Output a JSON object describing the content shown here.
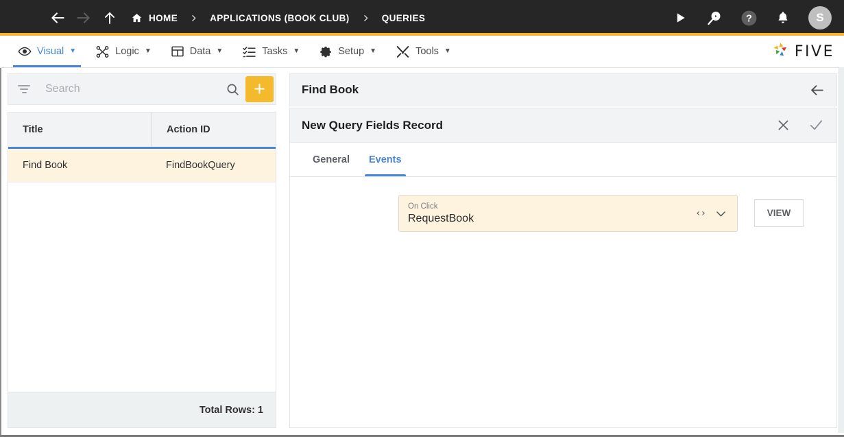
{
  "topbar": {
    "menu_icon": "hamburger-icon",
    "back_icon": "arrow-left-icon",
    "forward_icon": "arrow-right-icon",
    "up_icon": "arrow-up-icon",
    "breadcrumbs": [
      {
        "label": "HOME",
        "icon": "home-icon"
      },
      {
        "label": "APPLICATIONS (BOOK CLUB)",
        "icon": ""
      },
      {
        "label": "QUERIES",
        "icon": ""
      }
    ],
    "separator": "›",
    "actions": [
      {
        "name": "run-icon",
        "label": "Run"
      },
      {
        "name": "debug-search-icon",
        "label": "Debug"
      },
      {
        "name": "help-icon",
        "label": "Help"
      },
      {
        "name": "notifications-bell-icon",
        "label": "Notifications"
      }
    ],
    "avatar_initial": "S",
    "accent_color": "#f3b229",
    "background_color": "#262626"
  },
  "menubar": {
    "items": [
      {
        "label": "Visual",
        "icon": "eye-icon",
        "caret": "▼",
        "active": true
      },
      {
        "label": "Logic",
        "icon": "logic-nodes-icon",
        "caret": "▼",
        "active": false
      },
      {
        "label": "Data",
        "icon": "table-grid-icon",
        "caret": "▼",
        "active": false
      },
      {
        "label": "Tasks",
        "icon": "tasks-list-icon",
        "caret": "▼",
        "active": false
      },
      {
        "label": "Setup",
        "icon": "gear-icon",
        "caret": "▼",
        "active": false
      },
      {
        "label": "Tools",
        "icon": "tools-wrench-icon",
        "caret": "▼",
        "active": false
      }
    ],
    "logo_text": "FIVE",
    "active_color": "#4a86d8"
  },
  "sidebar": {
    "search": {
      "placeholder": "Search",
      "value": ""
    },
    "filter_icon": "filter-icon",
    "search_icon": "search-icon",
    "add_button_label": "+",
    "columns": [
      "Title",
      "Action ID"
    ],
    "rows": [
      {
        "title": "Find Book",
        "action_id": "FindBookQuery",
        "selected": true
      }
    ],
    "footer": "Total Rows: 1",
    "selected_row_color": "#fdf3de",
    "header_underline_color": "#4a86d8"
  },
  "main": {
    "panel_title": "Find Book",
    "back_icon": "arrow-left-icon",
    "record": {
      "title": "New Query Fields Record",
      "cancel_icon": "close-icon",
      "confirm_icon": "check-icon",
      "tabs": [
        {
          "label": "General",
          "active": false
        },
        {
          "label": "Events",
          "active": true
        }
      ],
      "event_field": {
        "label": "On Click",
        "value": "RequestBook",
        "code_icon": "‹›",
        "expand_icon": "chevron-down-icon"
      },
      "view_button": "VIEW"
    },
    "annotation": {
      "type": "arrow",
      "color": "#e02020"
    }
  }
}
